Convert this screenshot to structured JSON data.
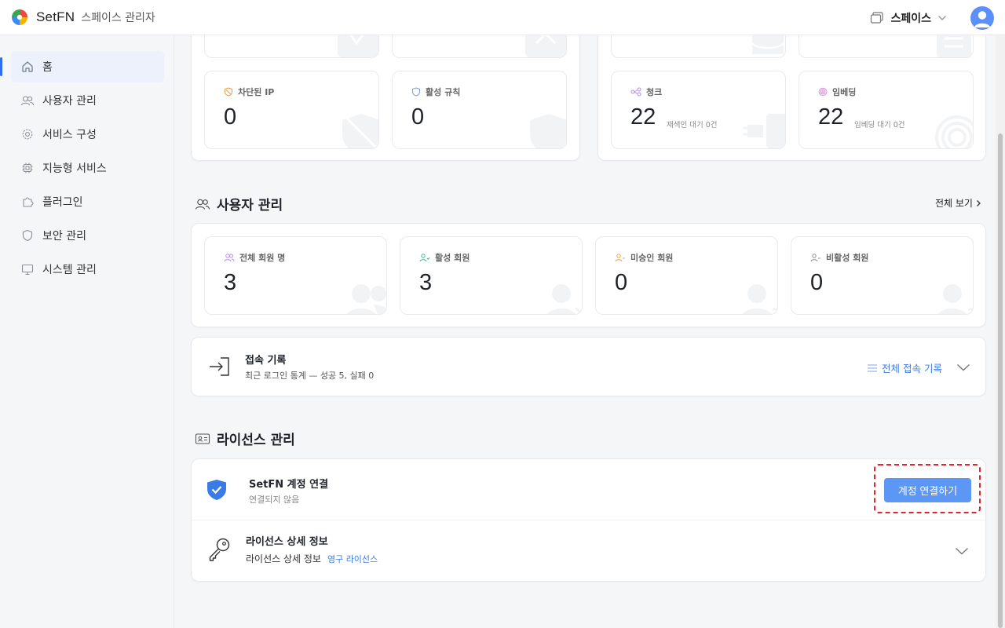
{
  "header": {
    "brand": "SetFN",
    "app_title": "스페이스 관리자",
    "space_label": "스페이스"
  },
  "sidebar": {
    "items": [
      {
        "label": "홈",
        "icon": "home-icon",
        "active": true
      },
      {
        "label": "사용자 관리",
        "icon": "users-icon"
      },
      {
        "label": "서비스 구성",
        "icon": "gear-icon"
      },
      {
        "label": "지능형 서비스",
        "icon": "chip-icon"
      },
      {
        "label": "플러그인",
        "icon": "puzzle-icon"
      },
      {
        "label": "보안 관리",
        "icon": "shield-icon"
      },
      {
        "label": "시스템 관리",
        "icon": "monitor-icon"
      }
    ]
  },
  "security_stats": {
    "blocked_ip": {
      "label": "차단된 IP",
      "value": "0"
    },
    "active_rules": {
      "label": "활성 규칙",
      "value": "0"
    }
  },
  "data_stats": {
    "chunks": {
      "label": "청크",
      "value": "22",
      "sub": "재색인 대기 0건"
    },
    "embeddings": {
      "label": "임베딩",
      "value": "22",
      "sub": "임베딩 대기 0건"
    }
  },
  "user_section": {
    "title": "사용자 관리",
    "see_all": "전체 보기",
    "cards": [
      {
        "label": "전체 회원 명",
        "value": "3"
      },
      {
        "label": "활성 회원",
        "value": "3"
      },
      {
        "label": "미승인 회원",
        "value": "0"
      },
      {
        "label": "비활성 회원",
        "value": "0"
      }
    ]
  },
  "access_log": {
    "title": "접속 기록",
    "summary": "최근 로그인 통계 — 성공 5, 실패 0",
    "link": "전체 접속 기록"
  },
  "license_section": {
    "title": "라이선스 관리",
    "account": {
      "title": "SetFN 계정 연결",
      "status": "연결되지 않음",
      "button": "계정 연결하기"
    },
    "details": {
      "title": "라이선스 상세 정보",
      "label": "라이선스 상세 정보",
      "type": "영구 라이선스"
    }
  },
  "colors": {
    "accent": "#2f6fed",
    "button": "#5d97f5",
    "highlight_border": "#e0252e",
    "shield_blue": "#3b7be8"
  }
}
